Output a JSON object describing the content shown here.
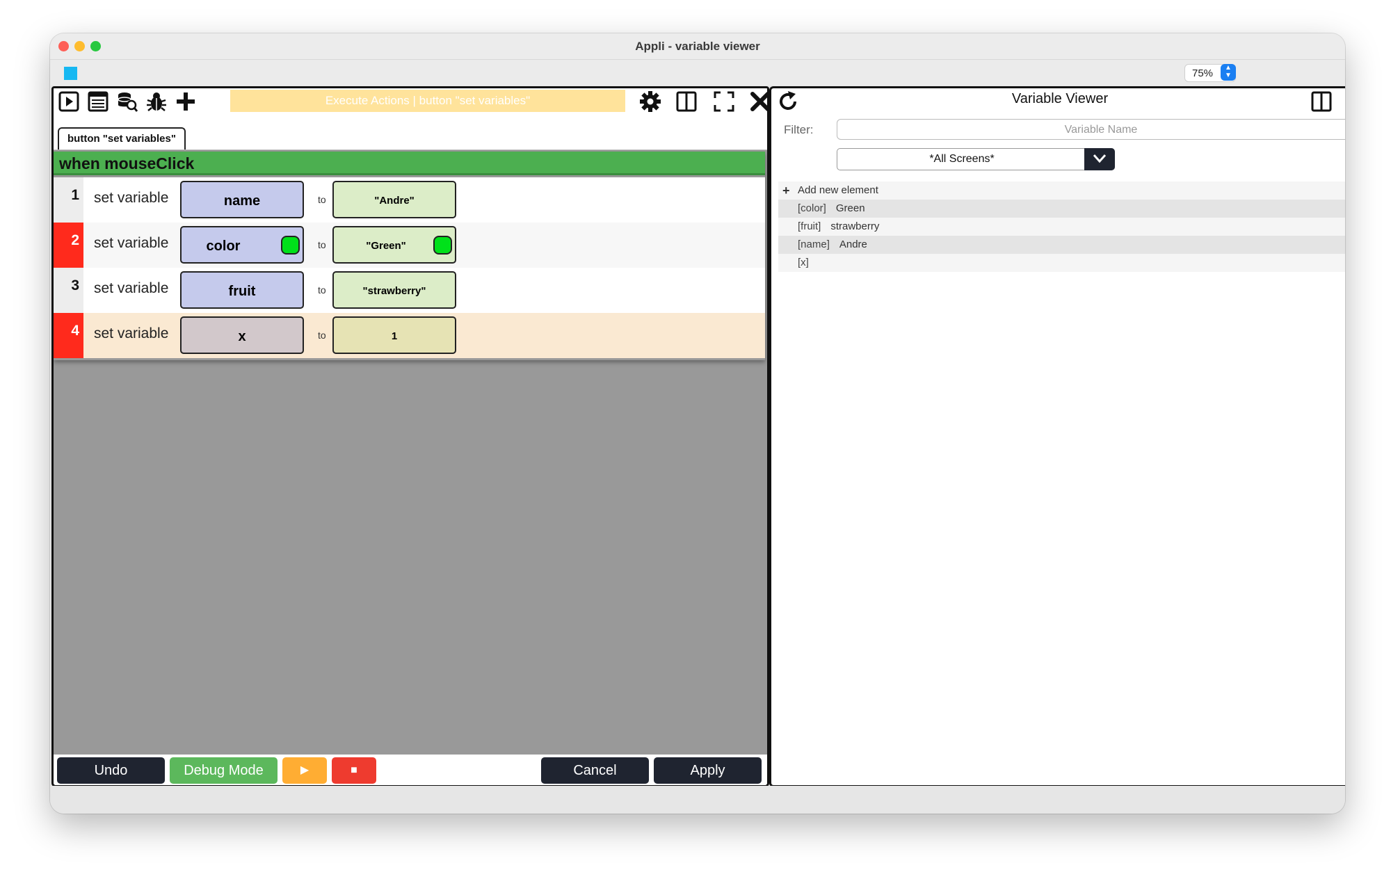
{
  "window": {
    "title": "Appli - variable viewer"
  },
  "zoom": {
    "value": "75%"
  },
  "toolbar": {
    "banner_text": "Execute Actions | button \"set variables\""
  },
  "editor": {
    "tab_label": "button \"set variables\"",
    "event_label": "when mouseClick",
    "rows": [
      {
        "num": "1",
        "label": "set variable",
        "var": "name",
        "to": "to",
        "value": "\"Andre\"",
        "dot": false
      },
      {
        "num": "2",
        "label": "set variable",
        "var": "color",
        "to": "to",
        "value": "\"Green\"",
        "dot": true
      },
      {
        "num": "3",
        "label": "set variable",
        "var": "fruit",
        "to": "to",
        "value": "\"strawberry\"",
        "dot": false
      },
      {
        "num": "4",
        "label": "set variable",
        "var": "x",
        "to": "to",
        "value": "1",
        "dot": false
      }
    ]
  },
  "bottom": {
    "undo": "Undo",
    "debug": "Debug Mode",
    "play": "▶",
    "stop": "■",
    "cancel": "Cancel",
    "apply": "Apply"
  },
  "viewer": {
    "title": "Variable Viewer",
    "filter_label": "Filter:",
    "filter_placeholder": "Variable Name",
    "screens_value": "*All Screens*",
    "add_new": "Add new element",
    "vars": [
      {
        "key": "[color]",
        "value": "Green"
      },
      {
        "key": "[fruit]",
        "value": "strawberry"
      },
      {
        "key": "[name]",
        "value": "Andre"
      },
      {
        "key": "[x]",
        "value": ""
      }
    ]
  },
  "colors": {
    "event_green": "#4caf50",
    "var_pill": "#c5caec",
    "value_pill": "#dcedc8",
    "error_red": "#ff2a1c",
    "debug_green": "#5cb85c",
    "play_orange": "#ffad33",
    "stop_red": "#ee3b2f",
    "dark_button": "#1f2430"
  }
}
